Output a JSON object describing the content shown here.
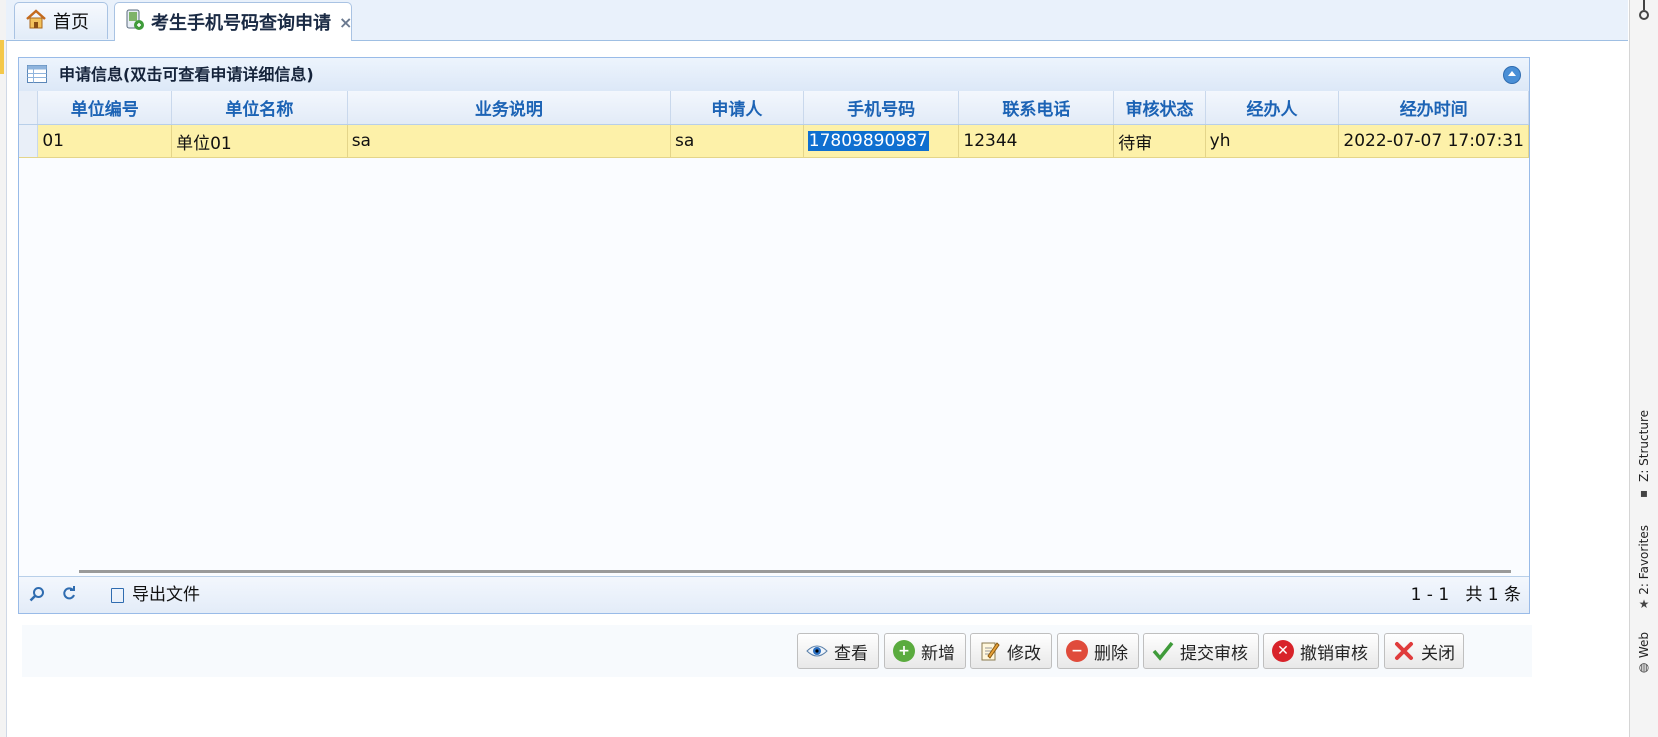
{
  "tabs": [
    {
      "label": "首页",
      "icon": "house-icon"
    },
    {
      "label": "考生手机号码查询申请",
      "icon": "phone-document-icon",
      "close": "×"
    }
  ],
  "panel": {
    "title": "申请信息(双击可查看申请详细信息)"
  },
  "table": {
    "columns": [
      "单位编号",
      "单位名称",
      "业务说明",
      "申请人",
      "手机号码",
      "联系电话",
      "审核状态",
      "经办人",
      "经办时间"
    ],
    "rows": [
      [
        "01",
        "单位01",
        "sa",
        "sa",
        "17809890987",
        "12344",
        "待审",
        "yh",
        "2022-07-07 17:07:31"
      ]
    ]
  },
  "pager": {
    "export_label": "导出文件",
    "range": "1 - 1",
    "total": "共 1 条"
  },
  "buttons": {
    "view": "查看",
    "add": "新增",
    "edit": "修改",
    "delete": "删除",
    "submit": "提交审核",
    "revoke": "撤销审核",
    "close": "关闭"
  },
  "ide": {
    "structure": "Z: Structure",
    "favorites": "2: Favorites",
    "web": "Web"
  },
  "colors": {
    "selected_row": "#fdf1a9",
    "header_text": "#1c63b5",
    "selection": "#0f6fd0"
  }
}
